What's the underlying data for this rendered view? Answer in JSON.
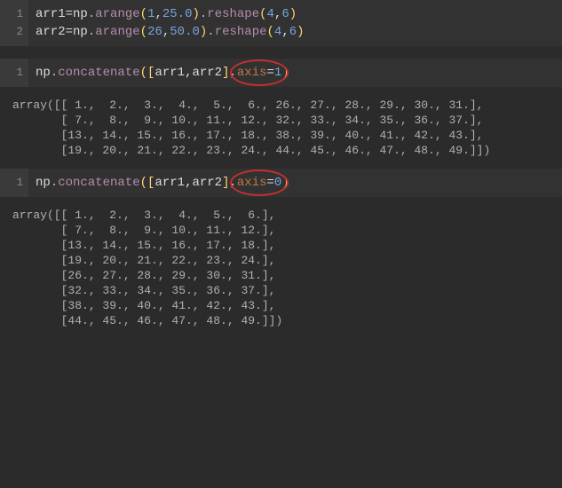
{
  "cell1": {
    "line1": {
      "var": "arr1",
      "eq": "=",
      "np": "np",
      "dot1": ".",
      "func1": "arange",
      "p1o": "(",
      "n1": "1",
      "c1": ",",
      "n2": "25.0",
      "p1c": ")",
      "dot2": ".",
      "func2": "reshape",
      "p2o": "(",
      "n3": "4",
      "c2": ",",
      "n4": "6",
      "p2c": ")"
    },
    "line2": {
      "var": "arr2",
      "eq": "=",
      "np": "np",
      "dot1": ".",
      "func1": "arange",
      "p1o": "(",
      "n1": "26",
      "c1": ",",
      "n2": "50.0",
      "p1c": ")",
      "dot2": ".",
      "func2": "reshape",
      "p2o": "(",
      "n3": "4",
      "c2": ",",
      "n4": "6",
      "p2c": ")"
    },
    "ln1": "1",
    "ln2": "2"
  },
  "cell2": {
    "ln": "1",
    "np": "np",
    "dot": ".",
    "func": "concatenate",
    "p1o": "(",
    "bro": "[",
    "a1": "arr1",
    "c1": ",",
    "a2": "arr2",
    "brc": "]",
    "c2": ",",
    "kw": "axis",
    "eq": "=",
    "val": "1",
    "p1c": ")"
  },
  "out1": "array([[ 1.,  2.,  3.,  4.,  5.,  6., 26., 27., 28., 29., 30., 31.],\n       [ 7.,  8.,  9., 10., 11., 12., 32., 33., 34., 35., 36., 37.],\n       [13., 14., 15., 16., 17., 18., 38., 39., 40., 41., 42., 43.],\n       [19., 20., 21., 22., 23., 24., 44., 45., 46., 47., 48., 49.]])",
  "cell3": {
    "ln": "1",
    "np": "np",
    "dot": ".",
    "func": "concatenate",
    "p1o": "(",
    "bro": "[",
    "a1": "arr1",
    "c1": ",",
    "a2": "arr2",
    "brc": "]",
    "c2": ",",
    "kw": "axis",
    "eq": "=",
    "val": "0",
    "p1c": ")"
  },
  "out2": "array([[ 1.,  2.,  3.,  4.,  5.,  6.],\n       [ 7.,  8.,  9., 10., 11., 12.],\n       [13., 14., 15., 16., 17., 18.],\n       [19., 20., 21., 22., 23., 24.],\n       [26., 27., 28., 29., 30., 31.],\n       [32., 33., 34., 35., 36., 37.],\n       [38., 39., 40., 41., 42., 43.],\n       [44., 45., 46., 47., 48., 49.]])"
}
